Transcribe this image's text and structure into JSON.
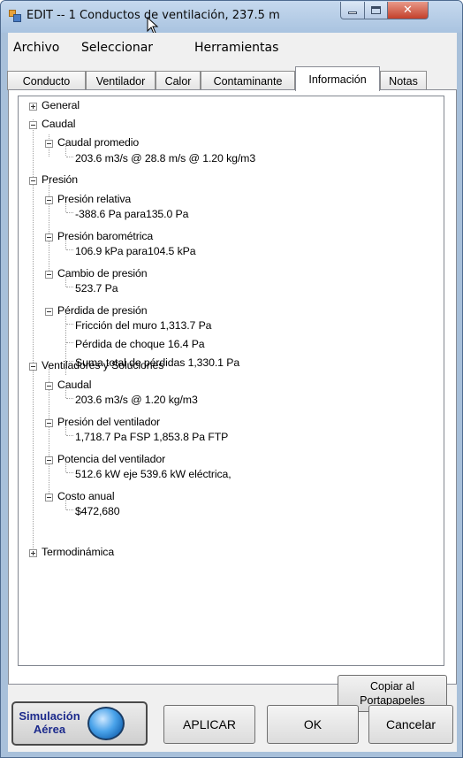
{
  "window": {
    "title": "EDIT -- 1 Conductos de ventilación, 237.5 m",
    "accent_color": "#a8c0da"
  },
  "menu": [
    "Archivo",
    "Seleccionar",
    "Herramientas"
  ],
  "tabs": [
    "Conducto",
    "Ventilador",
    "Calor",
    "Contaminante",
    "Información",
    "Notas"
  ],
  "active_tab": "Información",
  "tree": {
    "general": "General",
    "caudal": "Caudal",
    "caudal_promedio": "Caudal promedio",
    "caudal_promedio_value": "203.6 m3/s  @  28.8 m/s  @  1.20 kg/m3",
    "presion": "Presión",
    "presion_relativa": "Presión relativa",
    "presion_relativa_value": "-388.6 Pa para135.0 Pa",
    "presion_barometrica": "Presión barométrica",
    "presion_barometrica_value": "106.9 kPa para104.5 kPa",
    "cambio_presion": "Cambio de presión",
    "cambio_presion_value": "523.7 Pa",
    "perdida_presion": "Pérdida de presión",
    "friccion": "Fricción del muro  1,313.7 Pa",
    "perdida_choque": "Pérdida de choque 16.4 Pa",
    "suma_total": "Suma total de pérdidas  1,330.1 Pa",
    "ventiladores": "Ventiladores y Soluciones",
    "v_caudal": "Caudal",
    "v_caudal_value": "203.6 m3/s @ 1.20 kg/m3",
    "presion_ventilador": "Presión del ventilador",
    "presion_ventilador_value": "1,718.7 Pa FSP  1,853.8 Pa FTP",
    "potencia_ventilador": "Potencia del ventilador",
    "potencia_ventilador_value": "512.6 kW eje   539.6 kW eléctrica,",
    "costo_anual": "Costo anual",
    "costo_anual_value": "$472,680",
    "termodinamica": "Termodinámica"
  },
  "buttons": {
    "copy_line1": "Copiar al",
    "copy_line2": "Portapapeles",
    "sim_line1": "Simulación",
    "sim_line2": "Aérea",
    "aplicar": "APLICAR",
    "ok": "OK",
    "cancelar": "Cancelar"
  }
}
